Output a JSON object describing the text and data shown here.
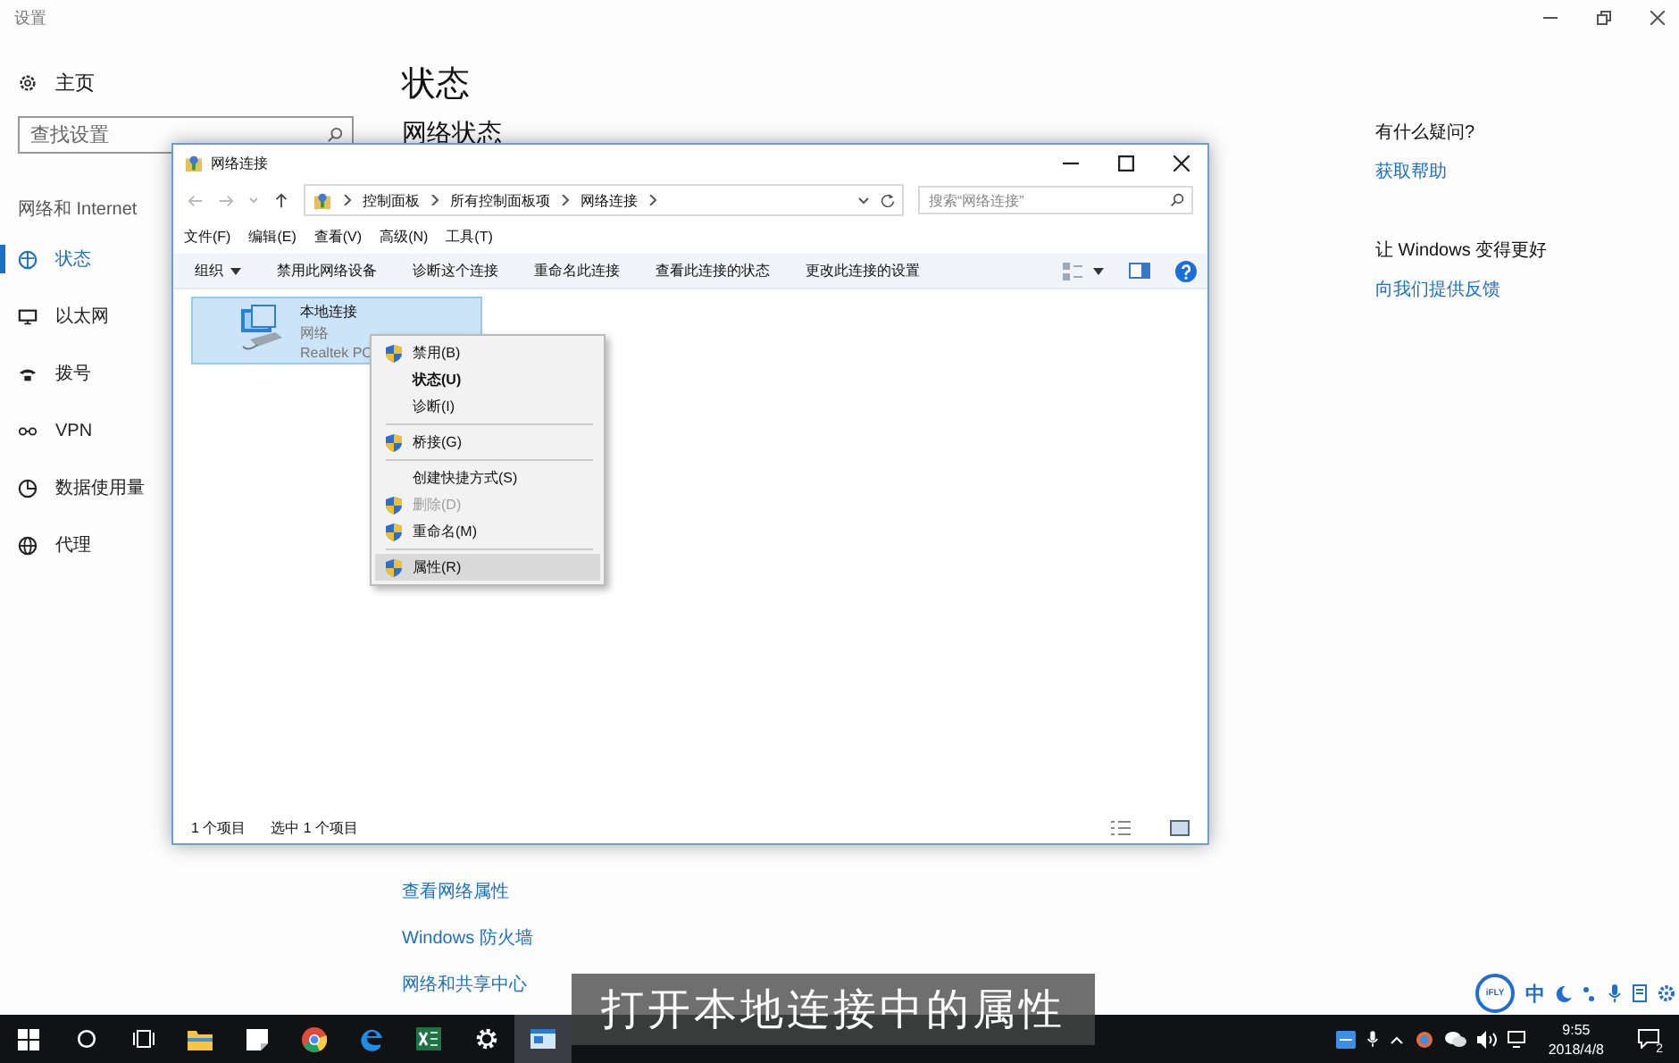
{
  "settings": {
    "title": "设置",
    "home": "主页",
    "search": {
      "placeholder": "查找设置"
    },
    "section": "网络和 Internet",
    "nav": [
      {
        "label": "状态",
        "kind": "status",
        "selected": true
      },
      {
        "label": "以太网",
        "kind": "ethernet",
        "selected": false
      },
      {
        "label": "拨号",
        "kind": "dialup",
        "selected": false
      },
      {
        "label": "VPN",
        "kind": "vpn",
        "selected": false
      },
      {
        "label": "数据使用量",
        "kind": "data",
        "selected": false
      },
      {
        "label": "代理",
        "kind": "proxy",
        "selected": false
      }
    ],
    "heading": "状态",
    "subheading": "网络状态",
    "links": [
      "查看网络属性",
      "Windows 防火墙",
      "网络和共享中心"
    ],
    "help": [
      {
        "title": "有什么疑问?",
        "link": "获取帮助"
      },
      {
        "title": "让 Windows 变得更好",
        "link": "向我们提供反馈"
      }
    ]
  },
  "explorer": {
    "title": "网络连接",
    "breadcrumb": [
      "控制面板",
      "所有控制面板项",
      "网络连接"
    ],
    "search": {
      "placeholder": "搜索“网络连接”"
    },
    "menu": [
      "文件(F)",
      "编辑(E)",
      "查看(V)",
      "高级(N)",
      "工具(T)"
    ],
    "commands": [
      {
        "label": "组织",
        "dropdown": true
      },
      {
        "label": "禁用此网络设备",
        "dropdown": false
      },
      {
        "label": "诊断这个连接",
        "dropdown": false
      },
      {
        "label": "重命名此连接",
        "dropdown": false
      },
      {
        "label": "查看此连接的状态",
        "dropdown": false
      },
      {
        "label": "更改此连接的设置",
        "dropdown": false
      }
    ],
    "item": {
      "name": "本地连接",
      "type": "网络",
      "adapter": "Realtek PC",
      "selected": true
    },
    "status": [
      "1 个项目",
      "选中 1 个项目"
    ]
  },
  "context_menu": [
    {
      "kind": "shield",
      "label": "禁用(B)",
      "bold": false,
      "disabled": false,
      "selected": false
    },
    {
      "kind": "plain",
      "label": "状态(U)",
      "bold": true,
      "disabled": false,
      "selected": false
    },
    {
      "kind": "plain",
      "label": "诊断(I)",
      "bold": false,
      "disabled": false,
      "selected": false
    },
    {
      "kind": "separator"
    },
    {
      "kind": "shield",
      "label": "桥接(G)",
      "bold": false,
      "disabled": false,
      "selected": false
    },
    {
      "kind": "separator"
    },
    {
      "kind": "plain",
      "label": "创建快捷方式(S)",
      "bold": false,
      "disabled": false,
      "selected": false
    },
    {
      "kind": "shield",
      "label": "删除(D)",
      "bold": false,
      "disabled": true,
      "selected": false
    },
    {
      "kind": "shield",
      "label": "重命名(M)",
      "bold": false,
      "disabled": false,
      "selected": false
    },
    {
      "kind": "separator"
    },
    {
      "kind": "shield",
      "label": "属性(R)",
      "bold": false,
      "disabled": false,
      "selected": true
    }
  ],
  "subtitle": "打开本地连接中的属性",
  "ime": {
    "logo": "iFLY",
    "mode": "中"
  },
  "taskbar": {
    "apps": [
      {
        "kind": "start",
        "selected": false
      },
      {
        "kind": "search",
        "selected": false
      },
      {
        "kind": "taskview",
        "selected": false
      },
      {
        "kind": "folder",
        "selected": false
      },
      {
        "kind": "note",
        "selected": false
      },
      {
        "kind": "chrome",
        "selected": false
      },
      {
        "kind": "edge",
        "selected": false
      },
      {
        "kind": "excel",
        "selected": false
      },
      {
        "kind": "gear",
        "selected": false
      },
      {
        "kind": "netwin",
        "selected": true
      }
    ],
    "time": "9:55",
    "date": "2018/4/8",
    "notifications": "2"
  }
}
